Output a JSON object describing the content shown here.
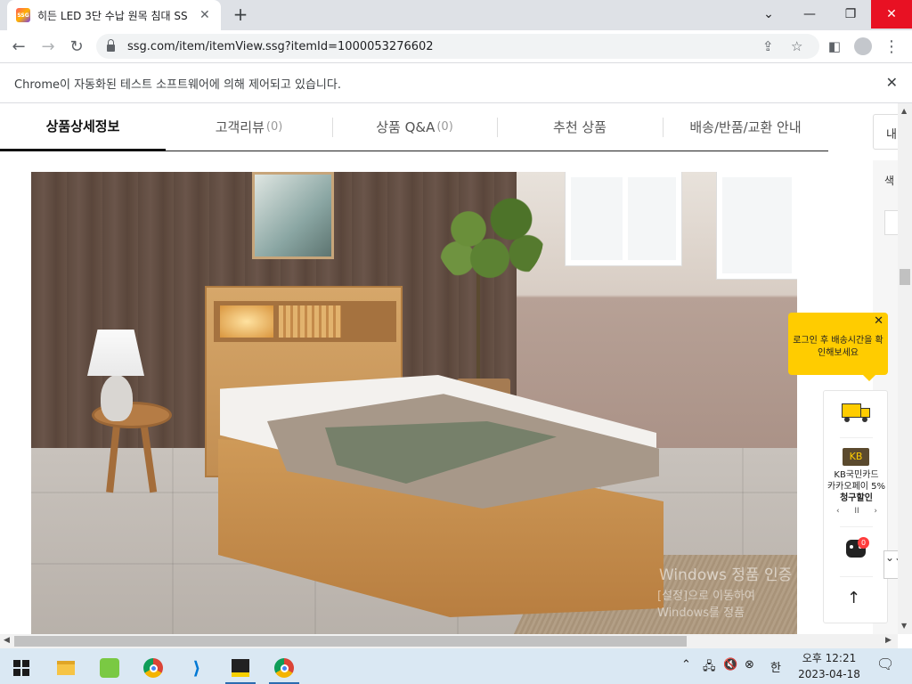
{
  "browser": {
    "tab": {
      "favicon_text": "SSG",
      "title": "히든 LED 3단 수납 원목 침대 SS"
    },
    "url": "ssg.com/item/itemView.ssg?itemId=1000053276602",
    "infobar": "Chrome이 자동화된 테스트 소프트웨어에 의해 제어되고 있습니다."
  },
  "product_tabs": [
    {
      "label": "상품상세정보",
      "count": ""
    },
    {
      "label": "고객리뷰",
      "count": "(0)"
    },
    {
      "label": "상품 Q&A",
      "count": "(0)"
    },
    {
      "label": "추천 상품",
      "count": ""
    },
    {
      "label": "배송/반품/교환 안내",
      "count": ""
    }
  ],
  "side_panel": {
    "edge_label": "내",
    "label": "색"
  },
  "windows_watermark": {
    "line1": "Windows 정품 인증",
    "line2": "[설정]으로 이동하여 Windows를 정품"
  },
  "tooltip": {
    "text": "로그인 후 배송시간을 확인해보세요"
  },
  "widget": {
    "card_logo": "KB",
    "card_text_line1": "KB국민카드",
    "card_text_line2": "카카오페이 5%",
    "card_text_line3": "청구할인",
    "pager_prev": "‹",
    "pager_pause": "II",
    "pager_next": "›",
    "chat_badge": "0",
    "top_label": "↑"
  },
  "chevron_button": "⌄⌄",
  "taskbar": {
    "clock_time": "오후 12:21",
    "clock_date": "2023-04-18",
    "ime": "한"
  },
  "colors": {
    "accent_yellow": "#ffcc00",
    "close_red": "#e81123"
  }
}
